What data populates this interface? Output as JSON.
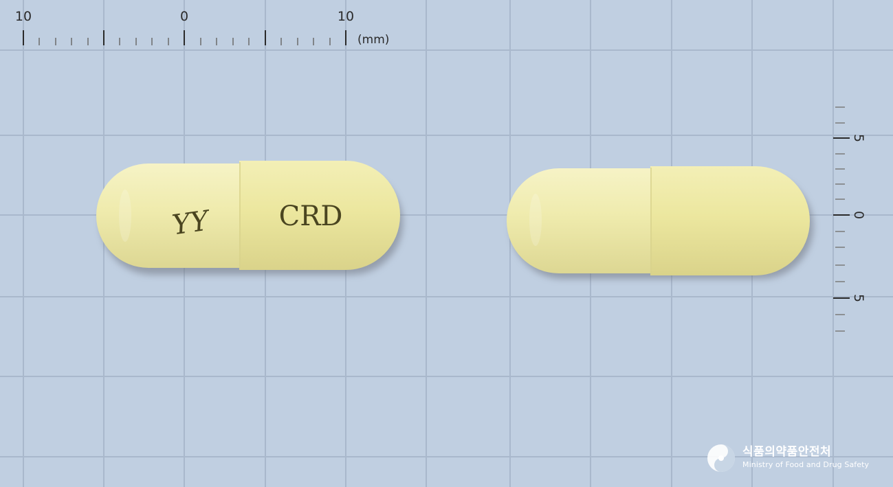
{
  "scale": {
    "horizontal_labels": [
      "10",
      "0",
      "10"
    ],
    "unit_label": "(mm)",
    "vertical_labels": [
      "5",
      "0",
      "5"
    ]
  },
  "capsules": [
    {
      "view": "front",
      "color": "#ede9a6",
      "imprint_left": "YY",
      "imprint_right": "CRD",
      "imprint_color": "#4a4520"
    },
    {
      "view": "back",
      "color": "#ede9a6",
      "imprint_left": "",
      "imprint_right": ""
    }
  ],
  "watermark": {
    "korean": "식품의약품안전처",
    "english": "Ministry of Food and Drug Safety"
  },
  "colors": {
    "background": "#c0cfe1",
    "grid": "#a9b8cc",
    "ruler": "#2a2a2a",
    "capsule": "#ede9a6"
  }
}
